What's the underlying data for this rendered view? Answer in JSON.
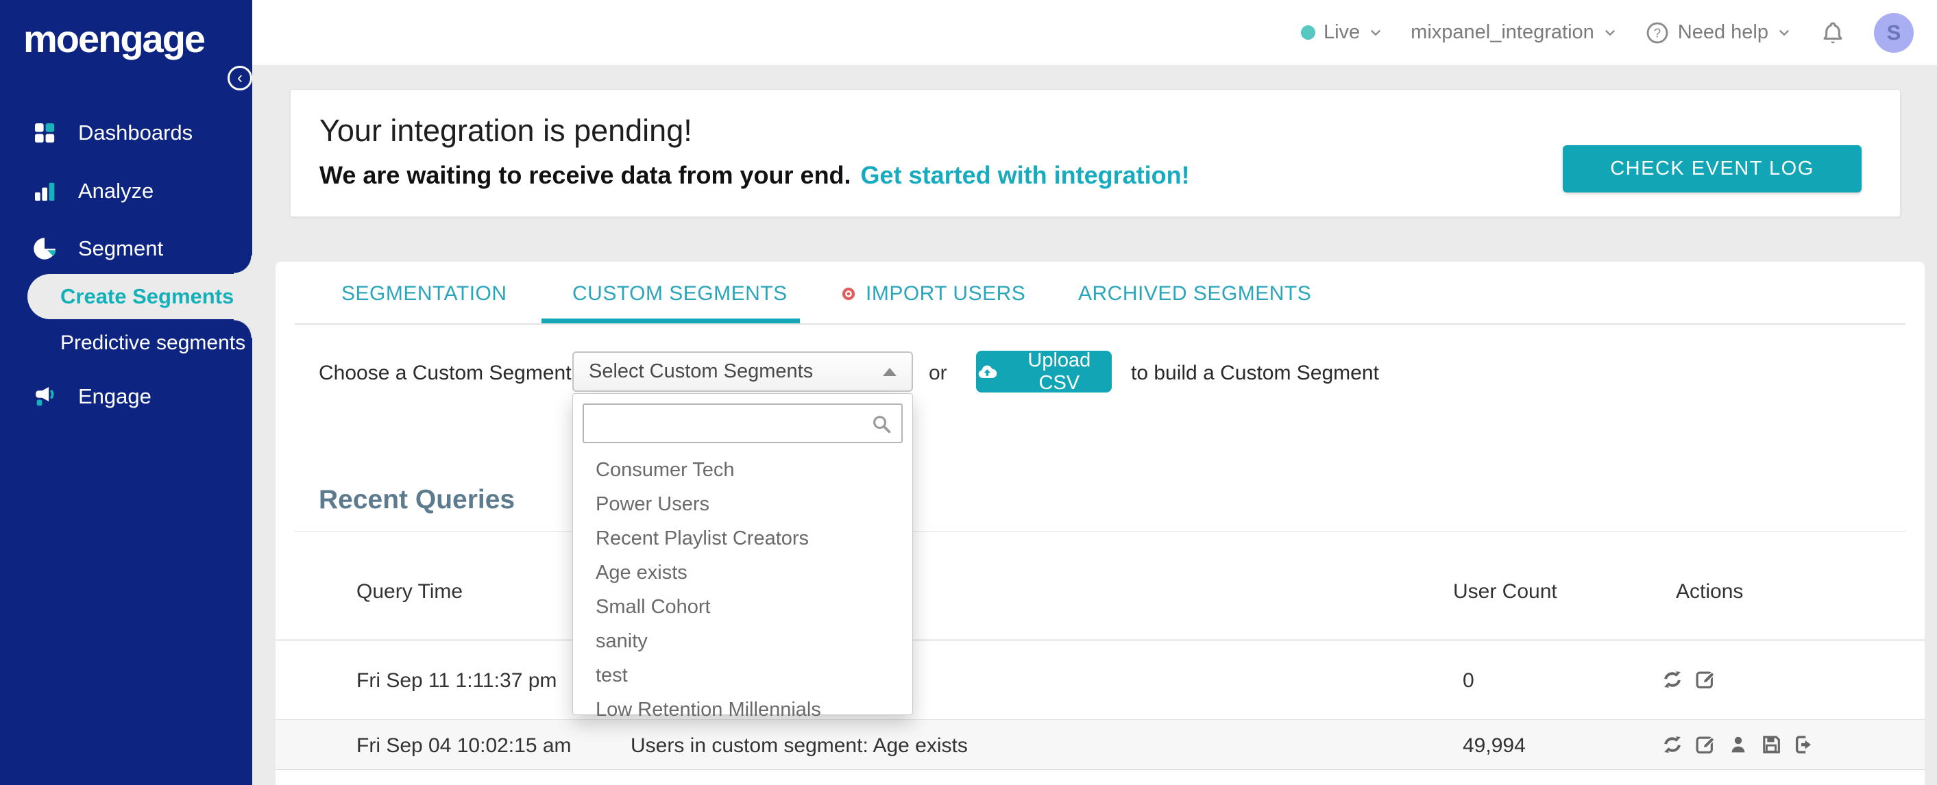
{
  "topbar": {
    "env_label": "Live",
    "workspace": "mixpanel_integration",
    "help_label": "Need help",
    "avatar_initial": "S"
  },
  "sidebar": {
    "logo": "moengage",
    "items": [
      {
        "label": "Dashboards",
        "icon": "grid-icon"
      },
      {
        "label": "Analyze",
        "icon": "bar-chart-icon"
      },
      {
        "label": "Segment",
        "icon": "pie-chart-icon"
      },
      {
        "label": "Create Segments",
        "active": true
      },
      {
        "label": "Predictive segments"
      },
      {
        "label": "Engage",
        "icon": "megaphone-icon"
      }
    ]
  },
  "banner": {
    "title": "Your integration is pending!",
    "subtitle": "We are waiting to receive data from your end.",
    "link": "Get started with integration!",
    "button": "CHECK EVENT LOG"
  },
  "tabs": [
    {
      "label": "SEGMENTATION"
    },
    {
      "label": "CUSTOM SEGMENTS",
      "active": true
    },
    {
      "label": "IMPORT USERS",
      "icon": "target-icon"
    },
    {
      "label": "ARCHIVED SEGMENTS"
    }
  ],
  "segment_chooser": {
    "label": "Choose a Custom Segment:",
    "dropdown_value": "Select Custom Segments",
    "or_text": "or",
    "upload_button": "Upload CSV",
    "suffix_text": "to build a Custom Segment",
    "search_value": ""
  },
  "dropdown_options": [
    "Consumer Tech",
    "Power Users",
    "Recent Playlist Creators",
    "Age exists",
    "Small Cohort",
    "sanity",
    "test",
    "Low Retention Millennials"
  ],
  "recent_queries": {
    "heading": "Recent Queries",
    "columns": [
      "Query Time",
      "User Count",
      "Actions"
    ],
    "rows": [
      {
        "query_time": "Fri Sep 11 1:11:37 pm",
        "query": "",
        "user_count": "0",
        "actions": [
          "refresh",
          "edit"
        ]
      },
      {
        "query_time": "Fri Sep 04 10:02:15 am",
        "query": "Users in custom segment: Age exists",
        "user_count": "49,994",
        "actions": [
          "refresh",
          "edit",
          "user",
          "save",
          "export"
        ]
      }
    ]
  },
  "colors": {
    "sidebar_blue": "#0d2481",
    "accent_teal": "#12a5b5",
    "tab_teal": "#2aa5bb",
    "heading_slate": "#5d7b8e",
    "import_badge_red": "#e25c5c",
    "avatar_bg": "#a9aef3",
    "live_dot": "#57c7c2",
    "page_bg": "#ebebeb"
  }
}
